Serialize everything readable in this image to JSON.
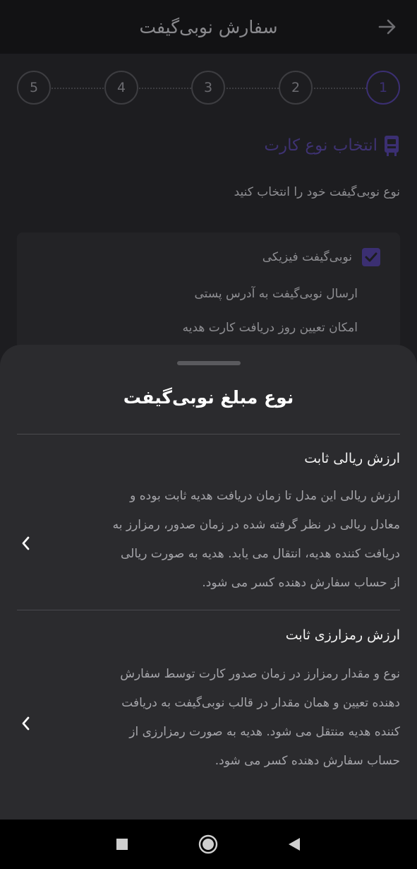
{
  "app_bar": {
    "title": "سفارش نوبی‌گیفت",
    "back_icon": "arrow-right-icon"
  },
  "stepper": {
    "steps": [
      "1",
      "2",
      "3",
      "4",
      "5"
    ],
    "active_step": 1
  },
  "section": {
    "icon": "gift-card-icon",
    "title": "انتخاب نوع کارت",
    "subtitle": "نوع نوبی‌گیفت خود را انتخاب کنید"
  },
  "card_type": {
    "checkbox_label": "نوبی‌گیفت فیزیکی",
    "checked": true,
    "lines": [
      "ارسال نوبی‌گیفت به آدرس پستی",
      "امکان تعیین روز دریافت کارت هدیه"
    ]
  },
  "sheet": {
    "title": "نوع مبلغ نوبی‌گیفت",
    "options": [
      {
        "title": "ارزش ریالی ثابت",
        "lines": [
          "ارزش ریالی این مدل تا زمان دریافت هدیه ثابت بوده و",
          "معادل ریالی در نظر گرفته شده در زمان صدور، رمزارز به",
          "دریافت کننده هدیه، انتقال می یابد. هدیه به صورت ریالی",
          "از حساب سفارش دهنده کسر می شود."
        ]
      },
      {
        "title": "ارزش رمزارزی ثابت",
        "lines": [
          "نوع و مقدار رمزارز در زمان صدور کارت توسط سفارش",
          "دهنده تعیین و همان مقدار در قالب نوبی‌گیفت به دریافت",
          "کننده هدیه منتقل می شود. هدیه به صورت رمزارزی از",
          "حساب سفارش دهنده کسر می شود."
        ]
      }
    ]
  },
  "system_nav": {
    "recents_icon": "square-icon",
    "home_icon": "circle-icon",
    "back_icon": "triangle-back-icon"
  },
  "colors": {
    "accent": "#3b2f72",
    "sheet_bg": "#2b2b2e",
    "page_bg": "#1d1d20"
  }
}
